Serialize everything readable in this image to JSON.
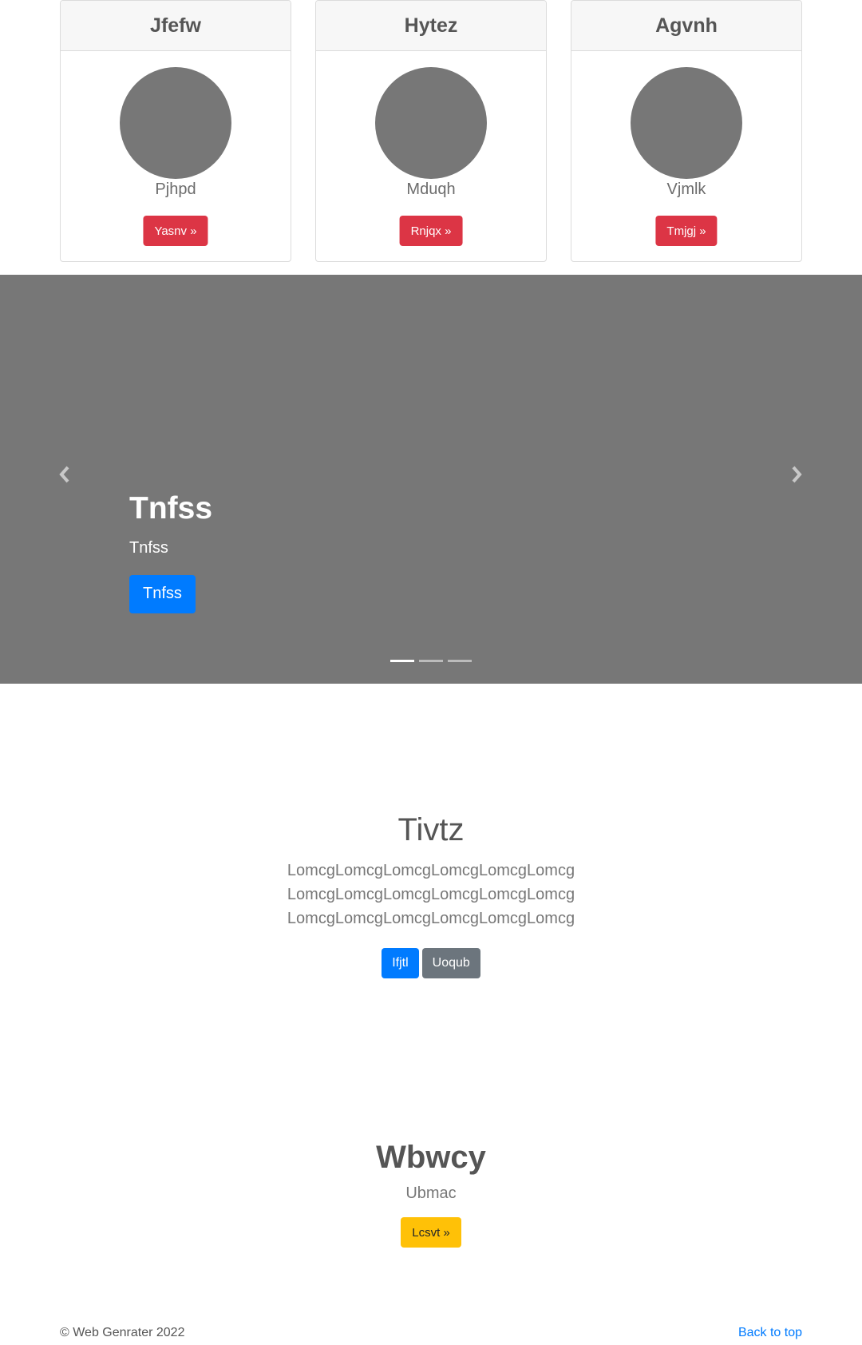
{
  "cards": [
    {
      "title": "Jfefw",
      "text": "Pjhpd",
      "button": "Yasnv »"
    },
    {
      "title": "Hytez",
      "text": "Mduqh",
      "button": "Rnjqx »"
    },
    {
      "title": "Agvnh",
      "text": "Vjmlk",
      "button": "Tmjgj »"
    }
  ],
  "carousel": {
    "title": "Tnfss",
    "text": "Tnfss",
    "button": "Tnfss",
    "indicator_count": 3,
    "active_index": 0
  },
  "jumbotron": {
    "title": "Tivtz",
    "lead_lines": [
      "LomcgLomcgLomcgLomcgLomcgLomcg",
      "LomcgLomcgLomcgLomcgLomcgLomcg",
      "LomcgLomcgLomcgLomcgLomcgLomcg"
    ],
    "primary_button": "Ifjtl",
    "secondary_button": "Uoqub"
  },
  "feature": {
    "title": "Wbwcy",
    "text": "Ubmac",
    "button": "Lcsvt »"
  },
  "footer": {
    "copyright": "© Web Genrater 2022",
    "back_to_top": "Back to top"
  },
  "colors": {
    "danger": "#dc3545",
    "primary": "#007bff",
    "secondary": "#6c757d",
    "warning": "#ffc107",
    "placeholder_gray": "#777777"
  }
}
